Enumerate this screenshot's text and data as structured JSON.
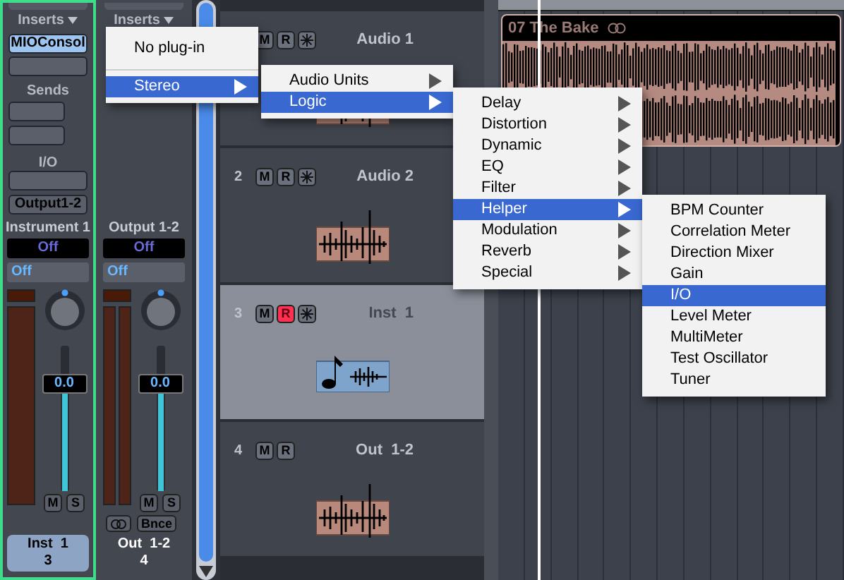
{
  "mixer": {
    "strips": [
      {
        "kind": "channel",
        "selected": true,
        "inserts_label": "Inserts",
        "inserts": [
          "MIOConsol"
        ],
        "sends_label": "Sends",
        "io_label": "I/O",
        "output": "Output1-2",
        "name": "Instrument 1",
        "automation": "Off",
        "group": "Off",
        "volume": "0.0",
        "level": 0.74,
        "mute": "M",
        "solo": "S",
        "footer": [
          "Inst  1",
          "3"
        ]
      },
      {
        "kind": "output",
        "selected": false,
        "inserts_label": "Inserts",
        "name": "Output 1-2",
        "automation": "Off",
        "group": "Off",
        "volume": "0.0",
        "level": 0.74,
        "mute": "M",
        "solo": "S",
        "bounce": "Bnce",
        "footer": [
          "Out  1-2",
          "4"
        ]
      }
    ]
  },
  "tracks": [
    {
      "kind": "audio",
      "name": "Audio 1",
      "mute": "M",
      "record": "R",
      "record_armed": false,
      "freeze": true,
      "selected": false
    },
    {
      "kind": "audio",
      "number": "2",
      "name": "Audio 2",
      "mute": "M",
      "record": "R",
      "record_armed": false,
      "freeze": true,
      "selected": false
    },
    {
      "kind": "instrument",
      "number": "3",
      "name": "Inst  1",
      "mute": "M",
      "record": "R",
      "record_armed": true,
      "freeze": true,
      "selected": true
    },
    {
      "kind": "audio",
      "number": "4",
      "name": "Out  1-2",
      "mute": "M",
      "record": "R",
      "record_armed": false,
      "freeze": false,
      "selected": false
    }
  ],
  "region": {
    "title": "07 The Bake"
  },
  "menus": [
    {
      "items": [
        {
          "label": "No plug-in",
          "selected": false,
          "submenu": false
        },
        {
          "kind": "separator"
        },
        {
          "label": "Stereo",
          "selected": true,
          "submenu": true
        }
      ]
    },
    {
      "items": [
        {
          "label": "Audio Units",
          "selected": false,
          "submenu": true
        },
        {
          "label": "Logic",
          "selected": true,
          "submenu": true
        }
      ]
    },
    {
      "items": [
        {
          "label": "Delay",
          "selected": false,
          "submenu": true
        },
        {
          "label": "Distortion",
          "selected": false,
          "submenu": true
        },
        {
          "label": "Dynamic",
          "selected": false,
          "submenu": true
        },
        {
          "label": "EQ",
          "selected": false,
          "submenu": true
        },
        {
          "label": "Filter",
          "selected": false,
          "submenu": true
        },
        {
          "label": "Helper",
          "selected": true,
          "submenu": true
        },
        {
          "label": "Modulation",
          "selected": false,
          "submenu": true
        },
        {
          "label": "Reverb",
          "selected": false,
          "submenu": true
        },
        {
          "label": "Special",
          "selected": false,
          "submenu": true
        }
      ]
    },
    {
      "items": [
        {
          "label": "BPM Counter",
          "selected": false,
          "submenu": false
        },
        {
          "label": "Correlation Meter",
          "selected": false,
          "submenu": false
        },
        {
          "label": "Direction Mixer",
          "selected": false,
          "submenu": false
        },
        {
          "label": "Gain",
          "selected": false,
          "submenu": false
        },
        {
          "label": "I/O",
          "selected": true,
          "submenu": false
        },
        {
          "label": "Level Meter",
          "selected": false,
          "submenu": false
        },
        {
          "label": "MultiMeter",
          "selected": false,
          "submenu": false
        },
        {
          "label": "Test Oscillator",
          "selected": false,
          "submenu": false
        },
        {
          "label": "Tuner",
          "selected": false,
          "submenu": false
        }
      ]
    }
  ]
}
